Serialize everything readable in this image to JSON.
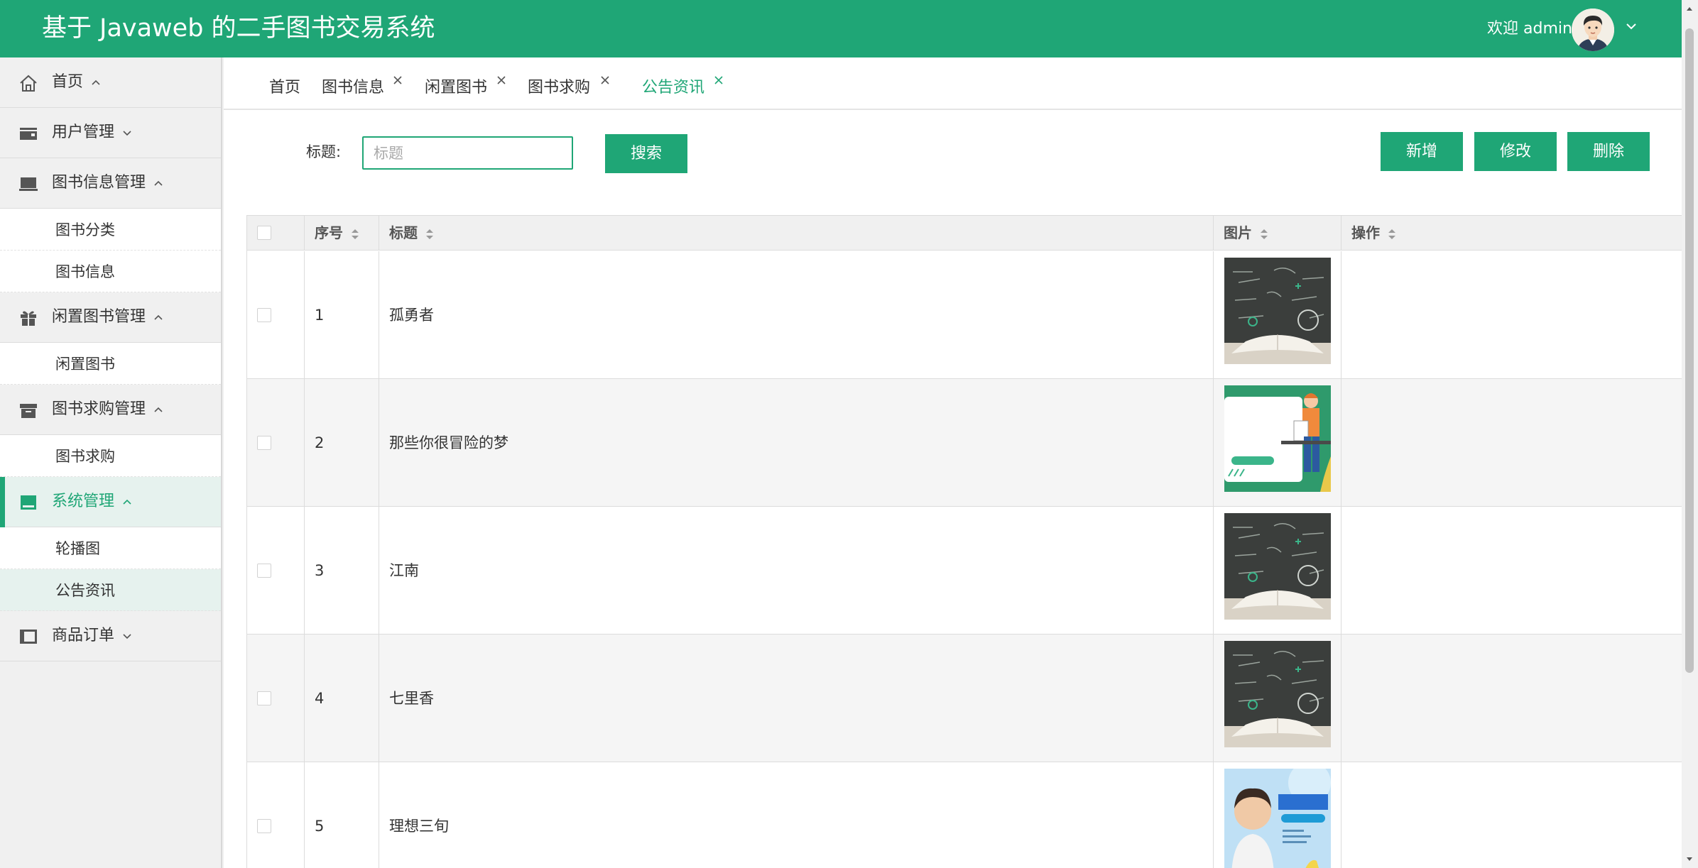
{
  "header": {
    "title": "基于 Javaweb 的二手图书交易系统",
    "welcome": "欢迎 admin"
  },
  "sidebar": {
    "home": "首页",
    "user_mgmt": "用户管理",
    "book_info_mgmt": "图书信息管理",
    "book_category": "图书分类",
    "book_info": "图书信息",
    "idle_book_mgmt": "闲置图书管理",
    "idle_book": "闲置图书",
    "book_request_mgmt": "图书求购管理",
    "book_request": "图书求购",
    "system_mgmt": "系统管理",
    "carousel": "轮播图",
    "announcement": "公告资讯",
    "product_order": "商品订单"
  },
  "tabs": {
    "home": "首页",
    "book_info": "图书信息",
    "idle_book": "闲置图书",
    "book_request": "图书求购",
    "announcement": "公告资讯"
  },
  "search": {
    "label": "标题:",
    "placeholder": "标题",
    "button": "搜索"
  },
  "actions": {
    "add": "新增",
    "edit": "修改",
    "delete": "删除"
  },
  "table": {
    "columns": {
      "index": "序号",
      "title": "标题",
      "image": "图片",
      "operation": "操作"
    },
    "rows": [
      {
        "index": "1",
        "title": "孤勇者",
        "image": "chalkboard-book"
      },
      {
        "index": "2",
        "title": "那些你很冒险的梦",
        "image": "teacher-whiteboard"
      },
      {
        "index": "3",
        "title": "江南",
        "image": "chalkboard-book"
      },
      {
        "index": "4",
        "title": "七里香",
        "image": "chalkboard-book"
      },
      {
        "index": "5",
        "title": "理想三旬",
        "image": "geography-course-banner"
      }
    ]
  },
  "colors": {
    "primary": "#1fa676",
    "header_bg": "#1fa676",
    "sidebar_bg": "#f0f0f0",
    "active_item_bg": "#e6f2ee"
  }
}
